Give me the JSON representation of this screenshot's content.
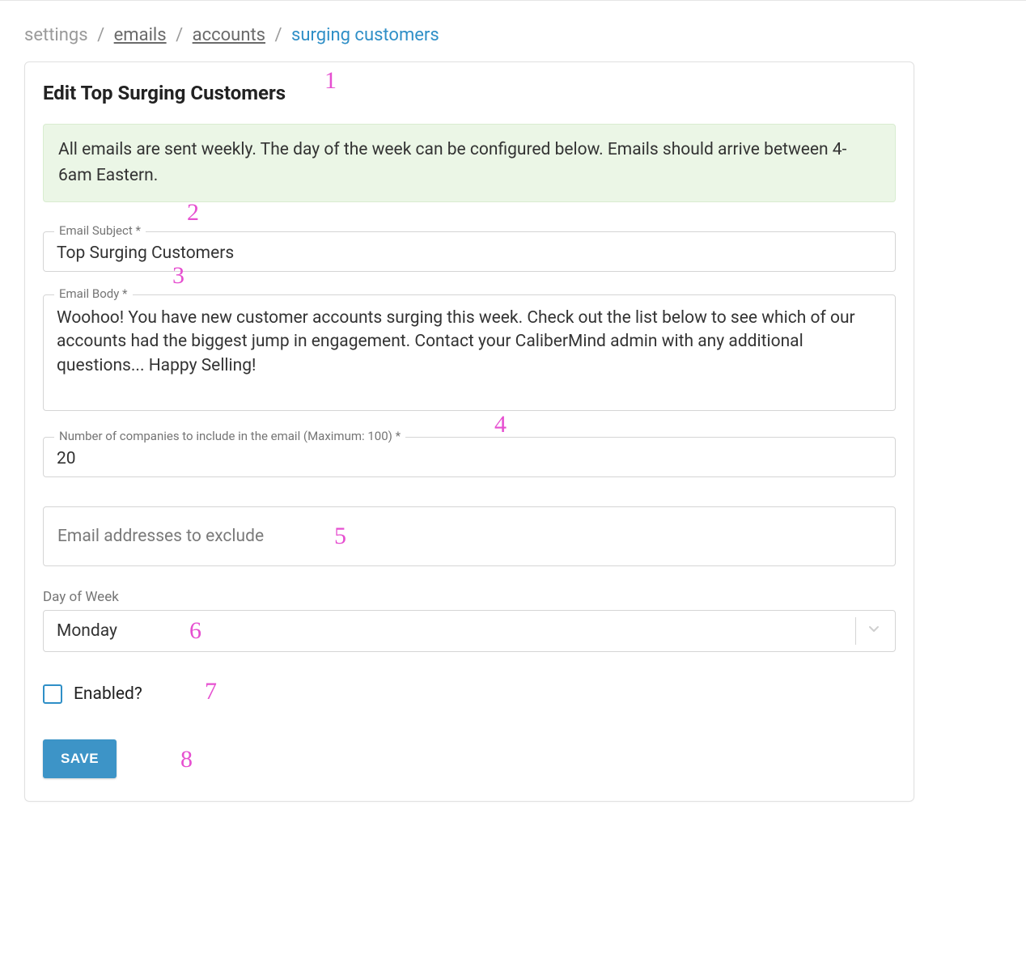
{
  "breadcrumb": {
    "items": [
      "settings",
      "emails",
      "accounts"
    ],
    "current": "surging customers"
  },
  "panel": {
    "title": "Edit Top Surging Customers",
    "alert": "All emails are sent weekly. The day of the week can be configured below. Emails should arrive between 4-6am Eastern."
  },
  "fields": {
    "subject": {
      "label": "Email Subject *",
      "value": "Top Surging Customers"
    },
    "body": {
      "label": "Email Body *",
      "value": "Woohoo! You have new customer accounts surging this week. Check out the list below to see which of our accounts had the biggest jump in engagement. Contact your CaliberMind admin with any additional questions... Happy Selling!"
    },
    "numCompanies": {
      "label": "Number of companies to include in the email (Maximum: 100) *",
      "value": "20"
    },
    "exclude": {
      "placeholder": "Email addresses to exclude",
      "value": ""
    },
    "dayOfWeek": {
      "label": "Day of Week",
      "value": "Monday"
    },
    "enabled": {
      "label": "Enabled?",
      "checked": false
    }
  },
  "actions": {
    "save": "SAVE"
  },
  "annotations": [
    "1",
    "2",
    "3",
    "4",
    "5",
    "6",
    "7",
    "8"
  ]
}
